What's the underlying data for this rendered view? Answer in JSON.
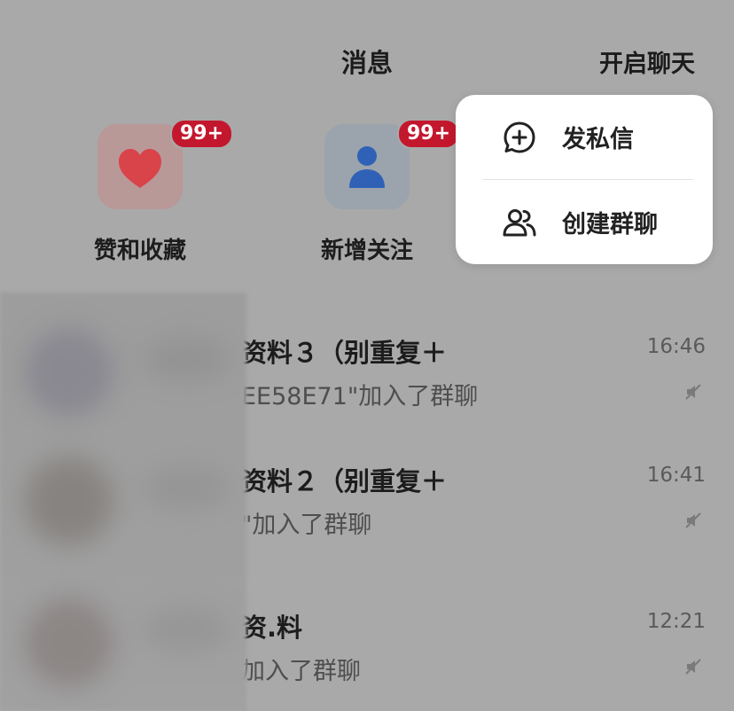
{
  "header": {
    "title": "消息",
    "start_chat": "开启聊天"
  },
  "quick_actions": [
    {
      "label": "赞和收藏",
      "badge": "99+",
      "icon": "heart-icon",
      "color": "#d9434a"
    },
    {
      "label": "新增关注",
      "badge": "99+",
      "icon": "person-icon",
      "color": "#2f62b6"
    }
  ],
  "menu": {
    "items": [
      {
        "label": "发私信",
        "icon": "chat-plus-icon"
      },
      {
        "label": "创建群聊",
        "icon": "group-icon"
      }
    ]
  },
  "conversations": [
    {
      "name": "资料３（别重复＋",
      "last_message": "EE58E71\"加入了群聊",
      "time": "16:46",
      "muted": true
    },
    {
      "name": "资料２（别重复＋",
      "last_message": "\"加入了群聊",
      "time": "16:41",
      "muted": true
    },
    {
      "name": "资.料",
      "last_message": "加入了群聊",
      "time": "12:21",
      "muted": true
    }
  ],
  "colors": {
    "badge": "#c3172e",
    "overlay": "#a9a9a9",
    "menu_bg": "#ffffff"
  }
}
